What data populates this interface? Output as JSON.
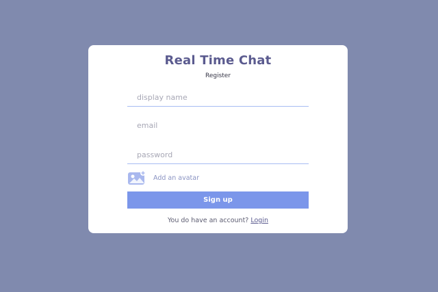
{
  "app": {
    "title": "Real Time Chat",
    "subtitle": "Register"
  },
  "form": {
    "display_name_placeholder": "display name",
    "email_placeholder": "email",
    "password_placeholder": "password",
    "avatar_label": "Add an avatar",
    "avatar_icon": "image-icon",
    "signup_label": "Sign up"
  },
  "footer": {
    "text": "You do have an account? ",
    "login_label": "Login"
  },
  "colors": {
    "background": "#808aae",
    "card": "#ffffff",
    "title": "#5b5b8f",
    "accent": "#7b96ea",
    "underline": "#a7bcf3"
  }
}
